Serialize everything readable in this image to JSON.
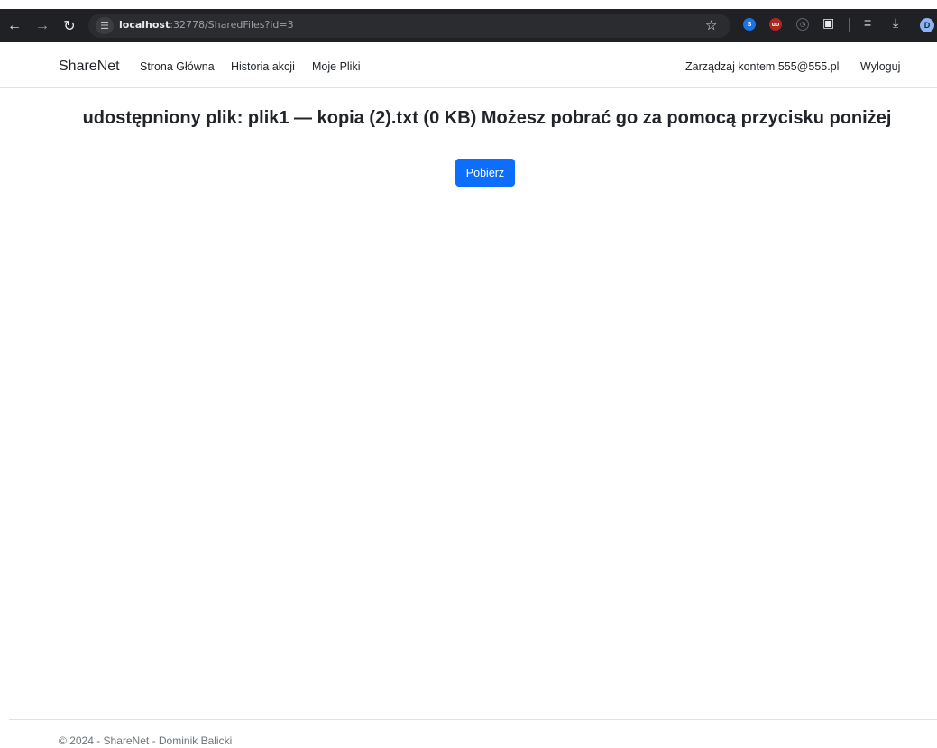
{
  "browser": {
    "url_host": "localhost",
    "url_rest": ":32778/SharedFiles?id=3",
    "profile_initial": "D"
  },
  "navbar": {
    "brand": "ShareNet",
    "links": [
      "Strona Główna",
      "Historia akcji",
      "Moje Pliki"
    ],
    "account": "Zarządzaj kontem 555@555.pl",
    "logout": "Wyloguj"
  },
  "main": {
    "heading": "udostępniony plik: plik1 — kopia (2).txt (0 KB) Możesz pobrać go za pomocą przycisku poniżej",
    "download_label": "Pobierz"
  },
  "footer": {
    "text": "© 2024 - ShareNet - Dominik Balicki"
  },
  "colors": {
    "primary": "#0d6efd",
    "browser_dark": "#202124"
  }
}
